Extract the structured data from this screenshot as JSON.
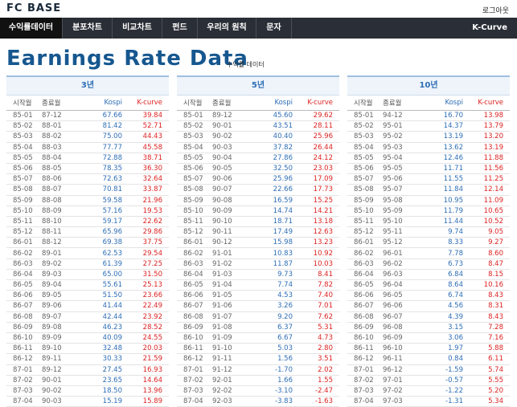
{
  "header": {
    "logo": "FC BASE",
    "logout": "로그아웃"
  },
  "nav": {
    "items": [
      "수익률데이터",
      "분포차트",
      "비교차트",
      "펀드",
      "우리의 원칙",
      "문자"
    ],
    "right": "K-Curve"
  },
  "page": {
    "title": "Earnings Rate Data",
    "subtitle": "수익률 데이터"
  },
  "columns": {
    "start": "시작월",
    "end": "종료월",
    "kospi": "Kospi",
    "kcurve": "K-curve"
  },
  "panels": [
    {
      "title": "3년",
      "rows": [
        [
          "85-01",
          "87-12",
          "67.66",
          "39.84"
        ],
        [
          "85-02",
          "88-01",
          "81.42",
          "52.71"
        ],
        [
          "85-03",
          "88-02",
          "75.00",
          "44.43"
        ],
        [
          "85-04",
          "88-03",
          "77.77",
          "45.58"
        ],
        [
          "85-05",
          "88-04",
          "72.88",
          "38.71"
        ],
        [
          "85-06",
          "88-05",
          "78.35",
          "36.30"
        ],
        [
          "85-07",
          "88-06",
          "72.63",
          "32.64"
        ],
        [
          "85-08",
          "88-07",
          "70.81",
          "33.87"
        ],
        [
          "85-09",
          "88-08",
          "59.58",
          "21.96"
        ],
        [
          "85-10",
          "88-09",
          "57.16",
          "19.53"
        ],
        [
          "85-11",
          "88-10",
          "59.17",
          "22.62"
        ],
        [
          "85-12",
          "88-11",
          "65.96",
          "29.86"
        ],
        [
          "86-01",
          "88-12",
          "69.38",
          "37.75"
        ],
        [
          "86-02",
          "89-01",
          "62.53",
          "29.54"
        ],
        [
          "86-03",
          "89-02",
          "61.39",
          "27.25"
        ],
        [
          "86-04",
          "89-03",
          "65.00",
          "31.50"
        ],
        [
          "86-05",
          "89-04",
          "55.61",
          "25.13"
        ],
        [
          "86-06",
          "89-05",
          "51.50",
          "23.66"
        ],
        [
          "86-07",
          "89-06",
          "41.44",
          "22.49"
        ],
        [
          "86-08",
          "89-07",
          "42.44",
          "23.92"
        ],
        [
          "86-09",
          "89-08",
          "46.23",
          "28.52"
        ],
        [
          "86-10",
          "89-09",
          "40.09",
          "24.55"
        ],
        [
          "86-11",
          "89-10",
          "32.48",
          "20.03"
        ],
        [
          "86-12",
          "89-11",
          "30.33",
          "21.59"
        ],
        [
          "87-01",
          "89-12",
          "27.45",
          "16.93"
        ],
        [
          "87-02",
          "90-01",
          "23.65",
          "14.64"
        ],
        [
          "87-03",
          "90-02",
          "18.50",
          "13.96"
        ],
        [
          "87-04",
          "90-03",
          "15.19",
          "15.89"
        ]
      ]
    },
    {
      "title": "5년",
      "rows": [
        [
          "85-01",
          "89-12",
          "45.60",
          "29.62"
        ],
        [
          "85-02",
          "90-01",
          "43.51",
          "28.11"
        ],
        [
          "85-03",
          "90-02",
          "40.40",
          "25.96"
        ],
        [
          "85-04",
          "90-03",
          "37.82",
          "26.44"
        ],
        [
          "85-05",
          "90-04",
          "27.86",
          "24.12"
        ],
        [
          "85-06",
          "90-05",
          "32.50",
          "23.03"
        ],
        [
          "85-07",
          "90-06",
          "25.96",
          "17.09"
        ],
        [
          "85-08",
          "90-07",
          "22.66",
          "17.73"
        ],
        [
          "85-09",
          "90-08",
          "16.59",
          "15.25"
        ],
        [
          "85-10",
          "90-09",
          "14.74",
          "14.21"
        ],
        [
          "85-11",
          "90-10",
          "18.71",
          "13.18"
        ],
        [
          "85-12",
          "90-11",
          "17.49",
          "12.63"
        ],
        [
          "86-01",
          "90-12",
          "15.98",
          "13.23"
        ],
        [
          "86-02",
          "91-01",
          "10.83",
          "10.92"
        ],
        [
          "86-03",
          "91-02",
          "11.87",
          "10.03"
        ],
        [
          "86-04",
          "91-03",
          "9.73",
          "8.41"
        ],
        [
          "86-05",
          "91-04",
          "7.74",
          "7.82"
        ],
        [
          "86-06",
          "91-05",
          "4.53",
          "7.40"
        ],
        [
          "86-07",
          "91-06",
          "3.26",
          "7.01"
        ],
        [
          "86-08",
          "91-07",
          "9.20",
          "7.62"
        ],
        [
          "86-09",
          "91-08",
          "6.37",
          "5.31"
        ],
        [
          "86-10",
          "91-09",
          "6.67",
          "4.73"
        ],
        [
          "86-11",
          "91-10",
          "5.03",
          "2.80"
        ],
        [
          "86-12",
          "91-11",
          "1.56",
          "3.51"
        ],
        [
          "87-01",
          "91-12",
          "-1.70",
          "2.02"
        ],
        [
          "87-02",
          "92-01",
          "1.66",
          "1.55"
        ],
        [
          "87-03",
          "92-02",
          "-3.10",
          "-2.47"
        ],
        [
          "87-04",
          "92-03",
          "-3.83",
          "-1.63"
        ]
      ]
    },
    {
      "title": "10년",
      "rows": [
        [
          "85-01",
          "94-12",
          "16.70",
          "13.98"
        ],
        [
          "85-02",
          "95-01",
          "14.37",
          "13.79"
        ],
        [
          "85-03",
          "95-02",
          "13.19",
          "13.20"
        ],
        [
          "85-04",
          "95-03",
          "13.62",
          "13.19"
        ],
        [
          "85-05",
          "95-04",
          "12.46",
          "11.88"
        ],
        [
          "85-06",
          "95-05",
          "11.71",
          "11.56"
        ],
        [
          "85-07",
          "95-06",
          "11.55",
          "11.25"
        ],
        [
          "85-08",
          "95-07",
          "11.84",
          "12.14"
        ],
        [
          "85-09",
          "95-08",
          "10.95",
          "11.09"
        ],
        [
          "85-10",
          "95-09",
          "11.79",
          "10.65"
        ],
        [
          "85-11",
          "95-10",
          "11.44",
          "10.52"
        ],
        [
          "85-12",
          "95-11",
          "9.74",
          "9.05"
        ],
        [
          "86-01",
          "95-12",
          "8.33",
          "9.27"
        ],
        [
          "86-02",
          "96-01",
          "7.78",
          "8.60"
        ],
        [
          "86-03",
          "96-02",
          "6.73",
          "8.47"
        ],
        [
          "86-04",
          "96-03",
          "6.84",
          "8.15"
        ],
        [
          "86-05",
          "96-04",
          "8.64",
          "10.16"
        ],
        [
          "86-06",
          "96-05",
          "6.74",
          "8.43"
        ],
        [
          "86-07",
          "96-06",
          "4.56",
          "8.31"
        ],
        [
          "86-08",
          "96-07",
          "4.39",
          "8.43"
        ],
        [
          "86-09",
          "96-08",
          "3.15",
          "7.28"
        ],
        [
          "86-10",
          "96-09",
          "3.06",
          "7.16"
        ],
        [
          "86-11",
          "96-10",
          "1.97",
          "5.88"
        ],
        [
          "86-12",
          "96-11",
          "0.84",
          "6.11"
        ],
        [
          "87-01",
          "96-12",
          "-1.59",
          "5.74"
        ],
        [
          "87-02",
          "97-01",
          "-0.57",
          "5.55"
        ],
        [
          "87-03",
          "97-02",
          "-1.22",
          "5.20"
        ],
        [
          "87-04",
          "97-03",
          "-1.31",
          "5.34"
        ]
      ]
    }
  ]
}
